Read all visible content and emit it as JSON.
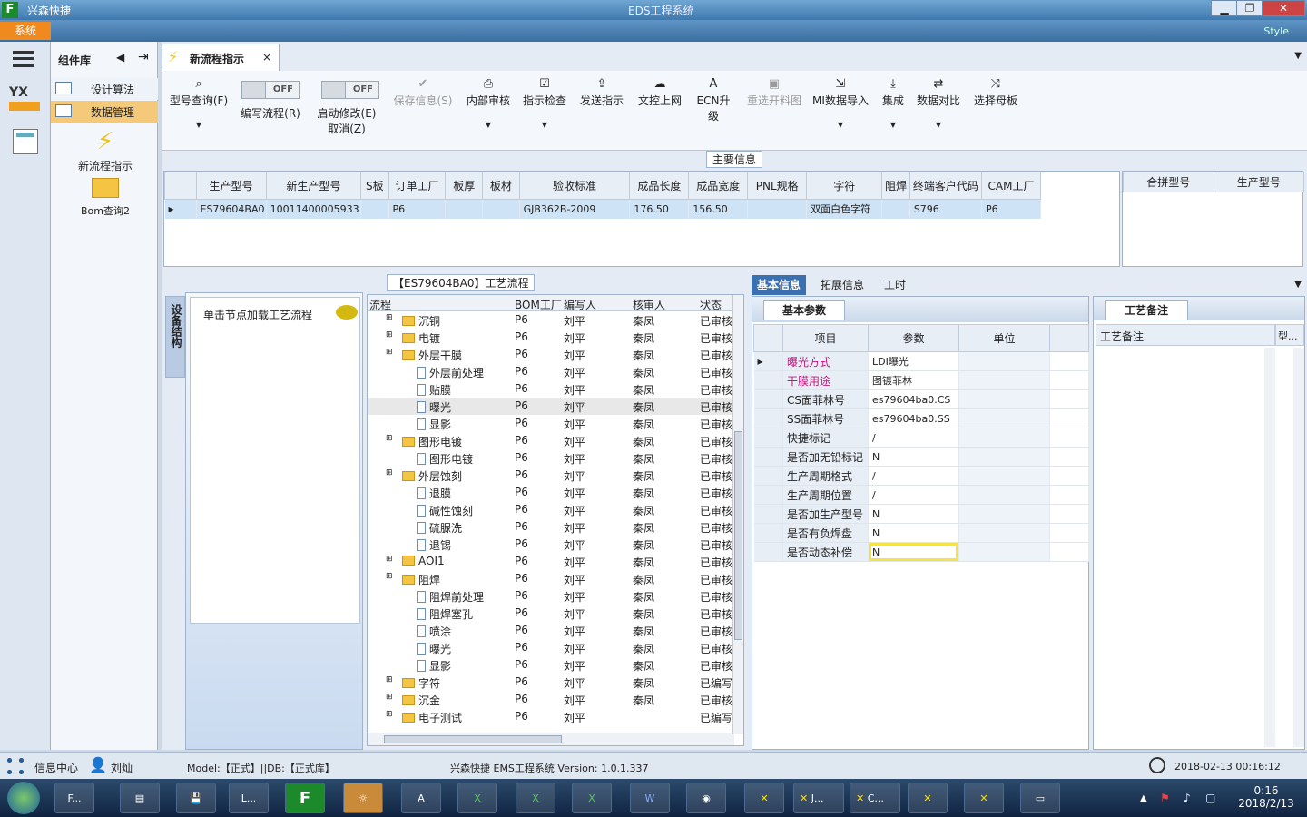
{
  "window": {
    "app_name": "兴森快捷",
    "title": "EDS工程系统",
    "min": "▁",
    "max": "❐",
    "close": "✕"
  },
  "menu": {
    "system": "系统",
    "style": "Style"
  },
  "components": {
    "title": "组件库",
    "items": [
      {
        "label": "设计算法"
      },
      {
        "label": "数据管理"
      }
    ],
    "launchers": [
      {
        "label": "新流程指示"
      },
      {
        "label": "Bom查询2"
      }
    ]
  },
  "leftbar": {
    "yx_logo": "YX"
  },
  "doc_tab": {
    "label": "新流程指示",
    "close": "×"
  },
  "toolbar": {
    "type_query": "型号查询(F)",
    "edit_flow": "编写流程(R)",
    "start_edit": "启动修改(E)",
    "cancel": "取消(Z)",
    "off": "OFF",
    "save_info": "保存信息(S)",
    "internal_review": "内部审核",
    "indication_check": "指示检查",
    "send_indication": "发送指示",
    "doc_upload": "文控上网",
    "ecn_upgrade": "ECN升级",
    "reselect_material": "重选开料图",
    "mi_import": "MI数据导入",
    "integrate": "集成",
    "data_compare": "数据对比",
    "select_mother": "选择母板"
  },
  "main_info": {
    "title": "主要信息",
    "columns": [
      "生产型号",
      "新生产型号",
      "S板",
      "订单工厂",
      "板厚",
      "板材",
      "验收标准",
      "成品长度",
      "成品宽度",
      "PNL规格",
      "字符",
      "阻焊",
      "终端客户代码",
      "CAM工厂"
    ],
    "row": [
      "ES79604BA0",
      "10011400005933",
      "",
      "P6",
      "",
      "",
      "GJB362B-2009",
      "176.50",
      "156.50",
      "",
      "双面白色字符",
      "",
      "S796",
      "P6"
    ],
    "side_columns": [
      "合拼型号",
      "生产型号"
    ]
  },
  "flow_panel": {
    "title": "【ES79604BA0】工艺流程",
    "side_tab": "设备结构",
    "hint": "单击节点加载工艺流程",
    "columns": [
      "流程",
      "BOM工厂",
      "编写人",
      "核审人",
      "状态"
    ],
    "rows": [
      {
        "name": "沉铜",
        "type": "folder",
        "level": 0,
        "bom": "P6",
        "writer": "刘平",
        "reviewer": "秦凤",
        "status": "已审核"
      },
      {
        "name": "电镀",
        "type": "folder",
        "level": 0,
        "bom": "P6",
        "writer": "刘平",
        "reviewer": "秦凤",
        "status": "已审核"
      },
      {
        "name": "外层干膜",
        "type": "folder",
        "level": 0,
        "bom": "P6",
        "writer": "刘平",
        "reviewer": "秦凤",
        "status": "已审核"
      },
      {
        "name": "外层前处理",
        "type": "doc",
        "level": 1,
        "bom": "P6",
        "writer": "刘平",
        "reviewer": "秦凤",
        "status": "已审核"
      },
      {
        "name": "贴膜",
        "type": "doc",
        "level": 1,
        "bom": "P6",
        "writer": "刘平",
        "reviewer": "秦凤",
        "status": "已审核"
      },
      {
        "name": "曝光",
        "type": "doc",
        "level": 1,
        "bom": "P6",
        "writer": "刘平",
        "reviewer": "秦凤",
        "status": "已审核",
        "selected": true
      },
      {
        "name": "显影",
        "type": "doc",
        "level": 1,
        "bom": "P6",
        "writer": "刘平",
        "reviewer": "秦凤",
        "status": "已审核"
      },
      {
        "name": "图形电镀",
        "type": "folder",
        "level": 0,
        "bom": "P6",
        "writer": "刘平",
        "reviewer": "秦凤",
        "status": "已审核"
      },
      {
        "name": "图形电镀",
        "type": "doc",
        "level": 1,
        "bom": "P6",
        "writer": "刘平",
        "reviewer": "秦凤",
        "status": "已审核"
      },
      {
        "name": "外层蚀刻",
        "type": "folder",
        "level": 0,
        "bom": "P6",
        "writer": "刘平",
        "reviewer": "秦凤",
        "status": "已审核"
      },
      {
        "name": "退膜",
        "type": "doc",
        "level": 1,
        "bom": "P6",
        "writer": "刘平",
        "reviewer": "秦凤",
        "status": "已审核"
      },
      {
        "name": "碱性蚀刻",
        "type": "doc",
        "level": 1,
        "bom": "P6",
        "writer": "刘平",
        "reviewer": "秦凤",
        "status": "已审核"
      },
      {
        "name": "硫脲洗",
        "type": "doc",
        "level": 1,
        "bom": "P6",
        "writer": "刘平",
        "reviewer": "秦凤",
        "status": "已审核"
      },
      {
        "name": "退锡",
        "type": "doc",
        "level": 1,
        "bom": "P6",
        "writer": "刘平",
        "reviewer": "秦凤",
        "status": "已审核"
      },
      {
        "name": "AOI1",
        "type": "folder",
        "level": 0,
        "bom": "P6",
        "writer": "刘平",
        "reviewer": "秦凤",
        "status": "已审核"
      },
      {
        "name": "阻焊",
        "type": "folder",
        "level": 0,
        "bom": "P6",
        "writer": "刘平",
        "reviewer": "秦凤",
        "status": "已审核"
      },
      {
        "name": "阻焊前处理",
        "type": "doc",
        "level": 1,
        "bom": "P6",
        "writer": "刘平",
        "reviewer": "秦凤",
        "status": "已审核"
      },
      {
        "name": "阻焊塞孔",
        "type": "doc",
        "level": 1,
        "bom": "P6",
        "writer": "刘平",
        "reviewer": "秦凤",
        "status": "已审核"
      },
      {
        "name": "喷涂",
        "type": "doc",
        "level": 1,
        "bom": "P6",
        "writer": "刘平",
        "reviewer": "秦凤",
        "status": "已审核"
      },
      {
        "name": "曝光",
        "type": "doc",
        "level": 1,
        "bom": "P6",
        "writer": "刘平",
        "reviewer": "秦凤",
        "status": "已审核"
      },
      {
        "name": "显影",
        "type": "doc",
        "level": 1,
        "bom": "P6",
        "writer": "刘平",
        "reviewer": "秦凤",
        "status": "已审核"
      },
      {
        "name": "字符",
        "type": "folder",
        "level": 0,
        "bom": "P6",
        "writer": "刘平",
        "reviewer": "秦凤",
        "status": "已编写"
      },
      {
        "name": "沉金",
        "type": "folder",
        "level": 0,
        "bom": "P6",
        "writer": "刘平",
        "reviewer": "秦凤",
        "status": "已审核"
      },
      {
        "name": "电子测试",
        "type": "folder",
        "level": 0,
        "bom": "P6",
        "writer": "刘平",
        "reviewer": "",
        "status": "已编写"
      }
    ]
  },
  "right_tabs": [
    "基本信息",
    "拓展信息",
    "工时"
  ],
  "basic_params": {
    "subtab": "基本参数",
    "columns": [
      "项目",
      "参数",
      "单位"
    ],
    "rows": [
      {
        "item": "曝光方式",
        "value": "LDI曝光",
        "unit": "",
        "pink": true
      },
      {
        "item": "干膜用途",
        "value": "图镀菲林",
        "unit": "",
        "pink": true
      },
      {
        "item": "CS面菲林号",
        "value": "es79604ba0.CS",
        "unit": ""
      },
      {
        "item": "SS面菲林号",
        "value": "es79604ba0.SS",
        "unit": ""
      },
      {
        "item": "快捷标记",
        "value": "/",
        "unit": ""
      },
      {
        "item": "是否加无铅标记",
        "value": "N",
        "unit": ""
      },
      {
        "item": "生产周期格式",
        "value": "/",
        "unit": ""
      },
      {
        "item": "生产周期位置",
        "value": "/",
        "unit": ""
      },
      {
        "item": "是否加生产型号",
        "value": "N",
        "unit": ""
      },
      {
        "item": "是否有负焊盘",
        "value": "N",
        "unit": ""
      },
      {
        "item": "是否动态补偿",
        "value": "N",
        "unit": "",
        "highlight": true
      }
    ]
  },
  "remarks": {
    "tab": "工艺备注",
    "col1": "工艺备注",
    "col2": "型..."
  },
  "status": {
    "info_center": "信息中心",
    "user": "刘灿",
    "model": "Model:【正式】||DB:【正式库】",
    "version": "兴森快捷 EMS工程系统 Version: 1.0.1.337",
    "datetime": "2018-02-13 00:16:12"
  },
  "taskbar": {
    "apps": [
      "F...",
      "L...",
      "J...",
      "C..."
    ],
    "time": "0:16",
    "date": "2018/2/13"
  }
}
